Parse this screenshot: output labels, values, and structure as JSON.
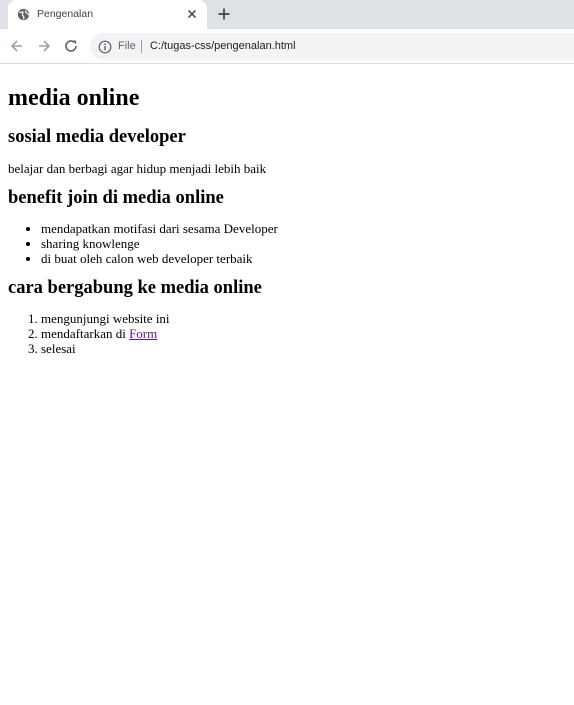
{
  "browser": {
    "tab": {
      "title": "Pengenalan",
      "favicon": "globe-icon"
    },
    "address": {
      "scheme_label": "File",
      "url": "C:/tugas-css/pengenalan.html"
    }
  },
  "page": {
    "title": "media online",
    "section1": {
      "heading": "sosial media developer",
      "text": "belajar dan berbagi agar hidup menjadi lebih baik"
    },
    "section2": {
      "heading": "benefit join di media online",
      "items": [
        "mendapatkan motifasi dari sesama Developer",
        "sharing knowlenge",
        "di buat oleh calon web developer terbaik"
      ]
    },
    "section3": {
      "heading": "cara bergabung ke media online",
      "items": [
        {
          "text": "mengunjungi website ini"
        },
        {
          "text": "mendaftarkan di ",
          "link": "Form"
        },
        {
          "text": "selesai"
        }
      ]
    }
  },
  "colors": {
    "link_visited": "#551a8b",
    "tabstrip": "#dee1e6",
    "omnibox": "#f1f3f4"
  }
}
